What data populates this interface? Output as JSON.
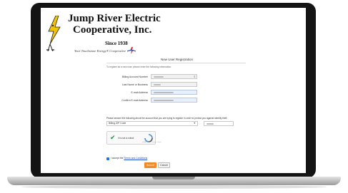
{
  "company": {
    "name_line1": "Jump River Electric",
    "name_line2": "Cooperative, Inc.",
    "since": "Since 1938",
    "tagline": "Your Touchstone Energy® Cooperative",
    "logo_icon": "lightning-mascot-icon",
    "coop_icon": "touchstone-energy-icon"
  },
  "form": {
    "title": "New User Registration",
    "intro": "To register as a new user, please enter the following information:",
    "fields": [
      {
        "label": "Billing Account Number"
      },
      {
        "label": "Last Name or Business"
      },
      {
        "label": "E-mail Address"
      },
      {
        "label": "Confirm E-mail Address"
      }
    ],
    "question": "Please answer the following about the account that you are trying to register in order to protect you against identity theft:",
    "select_value": "Billing ZIP Code",
    "captcha_label": "I'm not a robot",
    "captcha_sub": "reCAPTCHA · Privacy - Terms",
    "terms_prefix": "I accept the ",
    "terms_link": "Terms and Conditions",
    "submit_label": "Submit",
    "cancel_label": "Cancel"
  },
  "colors": {
    "accent": "#f08a24",
    "link": "#1a4ad1",
    "check": "#0a9d3a",
    "bezel": "#141414"
  }
}
